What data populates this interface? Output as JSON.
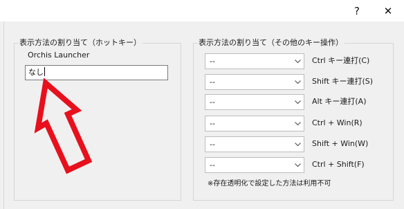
{
  "titlebar": {
    "help_label": "?",
    "close_label": "✕"
  },
  "hotkey_group": {
    "legend": "表示方法の割り当て（ホットキー）",
    "app_label": "Orchis Launcher",
    "input_value": "なし"
  },
  "other_keys_group": {
    "legend": "表示方法の割り当て（その他のキー操作）",
    "rows": [
      {
        "value": "--",
        "label": "Ctrl キー連打(C)"
      },
      {
        "value": "--",
        "label": "Shift キー連打(S)"
      },
      {
        "value": "--",
        "label": "Alt キー連打(A)"
      },
      {
        "value": "--",
        "label": "Ctrl + Win(R)"
      },
      {
        "value": "--",
        "label": "Shift + Win(W)"
      },
      {
        "value": "--",
        "label": "Ctrl + Shift(F)"
      }
    ],
    "note": "※存在透明化で設定した方法は利用不可"
  },
  "colors": {
    "arrow_outline": "#e8101c",
    "window_bg": "#f0f0f0",
    "border": "#d5d5d5"
  }
}
